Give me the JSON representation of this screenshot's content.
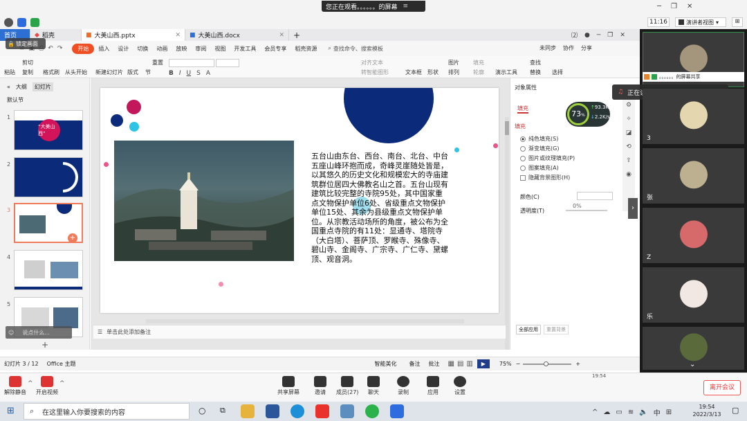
{
  "banner": {
    "text": "您正在观看。。。。。。的屏幕"
  },
  "topbar": {
    "time": "11:16",
    "view_mode": "演讲者视图"
  },
  "wps": {
    "doc_tabs": [
      {
        "label": "首页"
      },
      {
        "label": "稻壳"
      },
      {
        "label": "大美山西.pptx"
      },
      {
        "label": "大美山西.docx"
      }
    ],
    "lock_screen": "锁定画面",
    "ribbon_tabs": [
      "开始",
      "插入",
      "设计",
      "切换",
      "动画",
      "放映",
      "审阅",
      "视图",
      "开发工具",
      "会员专享",
      "稻壳资源"
    ],
    "search_cmd": "查找命令、搜索模板",
    "right_actions": [
      "未同步",
      "协作",
      "分享"
    ],
    "toolbar": {
      "paste": "粘贴",
      "cut": "剪切",
      "copy": "复制",
      "format_painter": "格式刷",
      "from_start": "从头开始",
      "new_slide": "新建幻灯片",
      "layout": "版式",
      "section": "节",
      "reset": "重置",
      "text_box": "文本框",
      "shape": "形状",
      "arrange": "排列",
      "picture": "图片",
      "fill": "填充",
      "outline": "轮廓",
      "convert_smart": "转智能图形",
      "align_text": "对齐文本",
      "presenter_tools": "演示工具",
      "find": "查找",
      "replace": "替换",
      "select": "选择"
    },
    "left_tabs": [
      "大纲",
      "幻灯片"
    ],
    "section_name": "默认节",
    "slides": [
      {
        "num": "1",
        "title": "“大美山西”"
      },
      {
        "num": "2"
      },
      {
        "num": "3"
      },
      {
        "num": "4"
      },
      {
        "num": "5"
      }
    ],
    "comment_placeholder": "说点什么...",
    "slide_text": "五台山由东台、西台、南台、北台、中台五座山峰环抱而成，奇峰灵崖随处皆是，以其悠久的历史文化和规模宏大的寺庙建筑群位居四大佛教名山之首。五台山现有建筑比较完整的寺院95处，其中国家重点文物保护单位6处、省级重点文物保护单位15处、其余为县级重点文物保护单位。从宗教活动场所的角度，被公布为全国重点寺院的有11处：显通寺、塔院寺（大白塔）、菩萨顶、罗睺寺、殊像寺、碧山寺、金阁寺、广宗寺、广仁寺、黛螺顶、观音洞。",
    "notes_placeholder": "单击此处添加备注",
    "right_panel": {
      "title": "对象属性",
      "tab": "填充",
      "section": "填充",
      "options": [
        "纯色填充(S)",
        "渐变填充(G)",
        "图片或纹理填充(P)",
        "图案填充(A)",
        "隐藏背景图形(H)"
      ],
      "color_label": "颜色(C)",
      "transparency_label": "透明度(T)",
      "transparency_value": "0%",
      "apply_all": "全部应用",
      "reset_bg": "重置背景"
    },
    "speed": {
      "percent": "73",
      "unit": "%",
      "up": "93.3",
      "down": "2.2",
      "rate_unit": "K/s"
    },
    "status": {
      "slide_info": "幻灯片 3 / 12",
      "theme": "Office 主题",
      "smart_beautify": "智能美化",
      "notes": "备注",
      "comments": "批注",
      "zoom": "75%"
    }
  },
  "video": {
    "share_text": "。。。。。。的屏幕共享",
    "speaking": "正在讲话：。。。。。；",
    "tiles": [
      {
        "name": ""
      },
      {
        "name": "3"
      },
      {
        "name": "张"
      },
      {
        "name": "Z"
      },
      {
        "name": "乐"
      },
      {
        "name": ""
      }
    ]
  },
  "meeting": {
    "unmute": "解除静音",
    "start_video": "开启视频",
    "share_screen": "共享屏幕",
    "invite": "邀请",
    "members": "成员(27)",
    "chat": "聊天",
    "record": "录制",
    "apps": "应用",
    "settings": "设置",
    "leave": "离开会议",
    "clock": "19:54"
  },
  "taskbar": {
    "search_placeholder": "在这里输入你要搜索的内容",
    "ime": "中",
    "time": "19:54",
    "date": "2022/3/13"
  },
  "colors": {
    "accent": "#f04e23",
    "navy": "#0b2a7a",
    "pink": "#d4145a"
  }
}
